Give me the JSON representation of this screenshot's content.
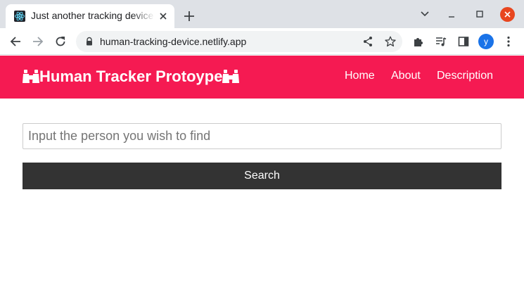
{
  "browser": {
    "tab_title": "Just another tracking device",
    "url": "human-tracking-device.netlify.app",
    "profile_initial": "y"
  },
  "navbar": {
    "brand": "Human Tracker Protoype",
    "links": [
      "Home",
      "About",
      "Description"
    ]
  },
  "search": {
    "placeholder": "Input the person you wish to find",
    "value": "",
    "button_label": "Search"
  },
  "colors": {
    "navbar_bg": "#f51a52",
    "button_bg": "#333333",
    "tabstrip_bg": "#dee1e6",
    "avatar_bg": "#1a73e8",
    "window_close": "#e8461f"
  },
  "icons": {
    "favicon": "react-icon",
    "brand": "binoculars-icon"
  }
}
